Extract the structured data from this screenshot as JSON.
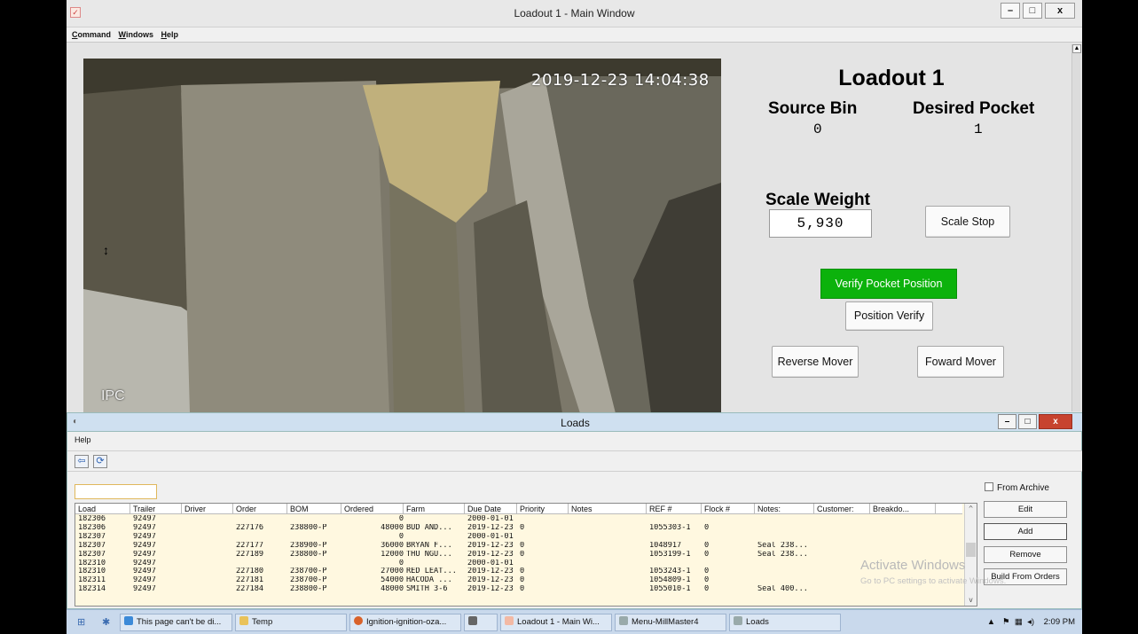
{
  "window": {
    "title": "Loadout 1 - Main Window",
    "btn_min": "–",
    "btn_max": "□",
    "btn_close": "x"
  },
  "menu": [
    "Command",
    "Windows",
    "Help"
  ],
  "camera": {
    "timestamp": "2019-12-23 14:04:38",
    "tag": "IPC"
  },
  "panel": {
    "title": "Loadout 1",
    "source_bin_label": "Source Bin",
    "source_bin_value": "0",
    "desired_pocket_label": "Desired Pocket",
    "desired_pocket_value": "1",
    "scale_weight_label": "Scale Weight",
    "scale_weight_value": "5,930",
    "scale_stop": "Scale Stop",
    "verify_pocket": "Verify Pocket Position",
    "position_verify": "Position Verify",
    "reverse_mover": "Reverse Mover",
    "forward_mover": "Foward Mover"
  },
  "loads": {
    "title": "Loads",
    "menu_help": "Help",
    "filter_value": "",
    "from_archive": "From Archive",
    "buttons": {
      "edit": "Edit",
      "add": "Add",
      "remove": "Remove",
      "build": "Build From Orders"
    },
    "columns": [
      "Load",
      "Trailer",
      "Driver",
      "Order",
      "BOM",
      "Ordered",
      "Farm",
      "Due Date",
      "Priority",
      "Notes",
      "REF #",
      "Flock #",
      "Notes:",
      "Customer:",
      "Breakdo..."
    ],
    "rows": [
      [
        "182306",
        "92497",
        "",
        "",
        "",
        "0",
        "",
        "2000-01-01",
        "",
        "",
        "",
        "",
        ""
      ],
      [
        "182306",
        "92497",
        "",
        "227176",
        "238800-P",
        "48000",
        "BUD AND...",
        "2019-12-23",
        "0",
        "",
        "1055303-1",
        "0",
        ""
      ],
      [
        "182307",
        "92497",
        "",
        "",
        "",
        "0",
        "",
        "2000-01-01",
        "",
        "",
        "",
        "",
        ""
      ],
      [
        "182307",
        "92497",
        "",
        "227177",
        "238900-P",
        "36000",
        "BRYAN F...",
        "2019-12-23",
        "0",
        "",
        "1048917",
        "0",
        "Seal 238..."
      ],
      [
        "182307",
        "92497",
        "",
        "227189",
        "238800-P",
        "12000",
        "THU NGU...",
        "2019-12-23",
        "0",
        "",
        "1053199-1",
        "0",
        "Seal 238..."
      ],
      [
        "182310",
        "92497",
        "",
        "",
        "",
        "0",
        "",
        "2000-01-01",
        "",
        "",
        "",
        "",
        ""
      ],
      [
        "182310",
        "92497",
        "",
        "227180",
        "238700-P",
        "27000",
        "RED LEAT...",
        "2019-12-23",
        "0",
        "",
        "1053243-1",
        "0",
        ""
      ],
      [
        "182311",
        "92497",
        "",
        "227181",
        "238700-P",
        "54000",
        "HACODA ...",
        "2019-12-23",
        "0",
        "",
        "1054809-1",
        "0",
        ""
      ],
      [
        "182314",
        "92497",
        "",
        "227184",
        "238800-P",
        "48000",
        "SMITH 3-6",
        "2019-12-23",
        "0",
        "",
        "1055010-1",
        "0",
        "Seal 400..."
      ]
    ],
    "watermark_title": "Activate Windows",
    "watermark_sub": "Go to PC settings to activate Windows."
  },
  "taskbar": {
    "items": [
      "This page can't be di...",
      "Temp",
      "Ignition-ignition-oza...",
      "",
      "Loadout 1 - Main Wi...",
      "Menu-MillMaster4",
      "Loads"
    ],
    "clock": "2:09 PM"
  },
  "colors": {
    "accent_green": "#0cb20c",
    "loads_close": "#c7432f",
    "grid_bg": "#fff8e0"
  }
}
